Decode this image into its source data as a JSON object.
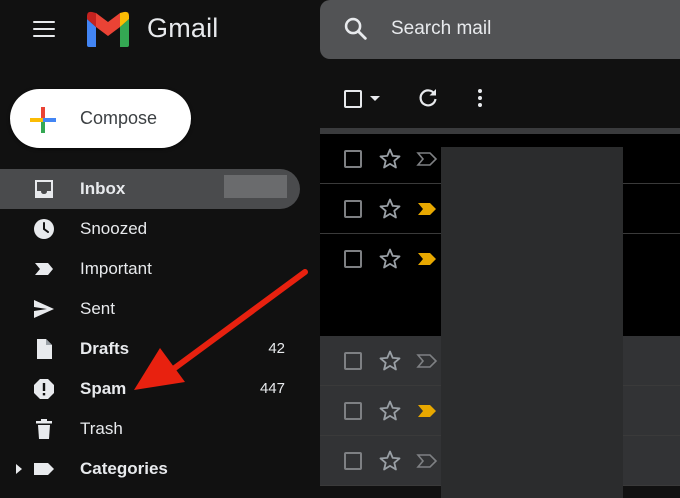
{
  "app": {
    "title": "Gmail"
  },
  "search": {
    "placeholder": "Search mail"
  },
  "compose": {
    "label": "Compose"
  },
  "sidebar": {
    "items": [
      {
        "label": "Inbox",
        "count": "",
        "icon": "inbox-icon",
        "active": true,
        "bold": true
      },
      {
        "label": "Snoozed",
        "count": "",
        "icon": "clock-icon",
        "active": false,
        "bold": false
      },
      {
        "label": "Important",
        "count": "",
        "icon": "important-icon",
        "active": false,
        "bold": false
      },
      {
        "label": "Sent",
        "count": "",
        "icon": "send-icon",
        "active": false,
        "bold": false
      },
      {
        "label": "Drafts",
        "count": "42",
        "icon": "draft-icon",
        "active": false,
        "bold": true
      },
      {
        "label": "Spam",
        "count": "447",
        "icon": "spam-icon",
        "active": false,
        "bold": true
      },
      {
        "label": "Trash",
        "count": "",
        "icon": "trash-icon",
        "active": false,
        "bold": false
      },
      {
        "label": "Categories",
        "count": "",
        "icon": "label-icon",
        "active": false,
        "bold": true
      }
    ]
  },
  "toolbar": {
    "select_icon": "checkbox-icon",
    "refresh_icon": "refresh-icon",
    "more_icon": "more-vert-icon"
  },
  "emails": [
    {
      "important": false,
      "unread": true
    },
    {
      "important": true,
      "unread": true
    },
    {
      "important": true,
      "unread": true
    },
    {
      "important": false,
      "unread": false
    },
    {
      "important": true,
      "unread": false
    },
    {
      "important": false,
      "unread": false
    }
  ],
  "colors": {
    "background": "#111111",
    "search_bg": "#525355",
    "active_nav": "#4a4b4d",
    "important_marker": "#e8a800",
    "annotation_arrow": "#e8210f"
  }
}
